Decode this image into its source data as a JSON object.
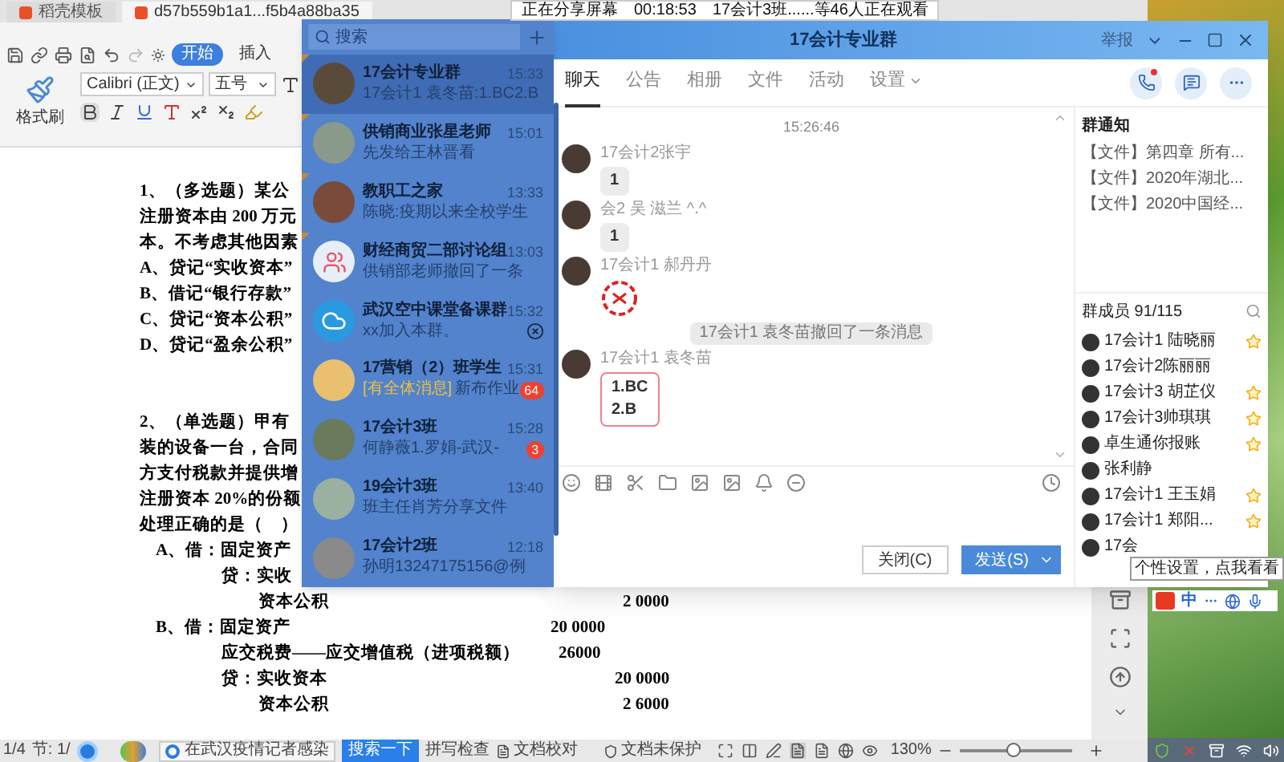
{
  "share_bar": {
    "status": "正在分享屏幕",
    "duration": "00:18:53",
    "viewers": "17会计3班......等46人正在观看"
  },
  "document_window": {
    "tabs": [
      {
        "label": "稻壳模板",
        "selected": false
      },
      {
        "label": "d57b559b1a1...f5b4a88ba35",
        "selected": true
      }
    ],
    "ribbon_tabs": [
      {
        "label": "开始",
        "selected": true
      },
      {
        "label": "插入",
        "selected": false
      }
    ],
    "format_painter": "格式刷",
    "font": "Calibri (正文)",
    "font_size": "五号",
    "lines": [
      {
        "kind": "question",
        "text": "1、（多选题）某公"
      },
      {
        "kind": "question",
        "text": "注册资本由 200 万元"
      },
      {
        "kind": "question",
        "text": "本。不考虑其他因素"
      },
      {
        "kind": "question",
        "text": "A、贷记“实收资本”"
      },
      {
        "kind": "question",
        "text": "B、借记“银行存款”"
      },
      {
        "kind": "question",
        "text": "C、贷记“资本公积”"
      },
      {
        "kind": "question",
        "text": "D、贷记“盈余公积”"
      },
      {
        "kind": "gap"
      },
      {
        "kind": "question",
        "text": "2、（单选题）甲有"
      },
      {
        "kind": "question",
        "text": "装的设备一台，合同"
      },
      {
        "kind": "question",
        "text": "方支付税款并提供增"
      },
      {
        "kind": "question",
        "text": "注册资本 20%的份额"
      },
      {
        "kind": "question",
        "text": "处理正确的是（　）"
      },
      {
        "kind": "entry",
        "text": "A、借：固定资产"
      },
      {
        "kind": "credit",
        "text": "贷：实收"
      },
      {
        "kind": "account",
        "text": "资本公积",
        "amount": "2 0000"
      },
      {
        "kind": "entry",
        "text": "B、借：固定资产",
        "amount": "20 0000"
      },
      {
        "kind": "tax",
        "text": "应交税费——应交增值税（进项税额）",
        "amount": "26000"
      },
      {
        "kind": "credit",
        "text": "贷：实收资本",
        "amount": "20 0000"
      },
      {
        "kind": "account",
        "text": "资本公积",
        "amount": "2 6000"
      }
    ],
    "status_bar": {
      "page": "1/4",
      "section": "节: 1/",
      "news": "在武汉疫情记者感染",
      "search_button": "搜索一下",
      "spell_check": "拼写检查",
      "proofread": "文档校对",
      "protection": "文档未保护",
      "zoom": "130%",
      "zoom_slider": {
        "level": 0.47
      }
    }
  },
  "chat_list": {
    "search_placeholder": "搜索",
    "items": [
      {
        "name": "17会计专业群",
        "time": "15:33",
        "preview": "17会计1 袁冬苗:1.BC2.B",
        "selected": true,
        "pinned": true,
        "avatar": {
          "kind": "photo"
        },
        "muted": false
      },
      {
        "name": "供销商业张星老师",
        "time": "15:01",
        "preview": "先发给王林晋看",
        "selected": false,
        "pinned": true,
        "avatar": {
          "kind": "photo"
        },
        "muted": false
      },
      {
        "name": "教职工之家",
        "time": "13:33",
        "preview": "陈晓:疫期以来全校学生",
        "selected": false,
        "pinned": true,
        "avatar": {
          "kind": "photo"
        },
        "muted": false
      },
      {
        "name": "财经商贸二部讨论组",
        "time": "13:03",
        "preview": "供销部老师撤回了一条",
        "selected": false,
        "pinned": true,
        "avatar": {
          "kind": "people"
        },
        "muted": false
      },
      {
        "name": "武汉空中课堂备课群",
        "time": "15:32",
        "preview": "xx加入本群。",
        "selected": false,
        "pinned": false,
        "avatar": {
          "kind": "cloud"
        },
        "muted": true
      },
      {
        "name": "17营销（2）班学生",
        "time": "15:31",
        "tag": "[有全体消息]",
        "preview": "新布作业",
        "badge": "64",
        "selected": false,
        "pinned": false,
        "avatar": {
          "kind": "photo"
        },
        "muted": false
      },
      {
        "name": "17会计3班",
        "time": "15:28",
        "preview": "何静薇1.罗娟-武汉-",
        "badge": "3",
        "selected": false,
        "pinned": false,
        "avatar": {
          "kind": "photo"
        },
        "muted": false
      },
      {
        "name": "19会计3班",
        "time": "13:40",
        "preview": "班主任肖芳分享文件",
        "selected": false,
        "pinned": false,
        "avatar": {
          "kind": "photo"
        },
        "muted": false
      },
      {
        "name": "17会计2班",
        "time": "12:18",
        "preview": "孙明13247175156@例",
        "selected": false,
        "pinned": false,
        "avatar": {
          "kind": "photo"
        },
        "muted": false
      }
    ]
  },
  "chat_window": {
    "title": "17会计专业群",
    "report": "举报",
    "tabs": [
      {
        "label": "聊天",
        "selected": true
      },
      {
        "label": "公告",
        "selected": false
      },
      {
        "label": "相册",
        "selected": false
      },
      {
        "label": "文件",
        "selected": false
      },
      {
        "label": "活动",
        "selected": false
      },
      {
        "label": "设置",
        "selected": false
      }
    ],
    "messages": [
      {
        "kind": "time",
        "text": "15:26:46"
      },
      {
        "kind": "text",
        "sender": "17会计2张宇",
        "lines": [
          "1"
        ],
        "highlighted": false
      },
      {
        "kind": "text",
        "sender": "会2 吴 滋兰 ^.^",
        "lines": [
          "1"
        ],
        "highlighted": false
      },
      {
        "kind": "sticker",
        "sender": "17会计1 郝丹丹"
      },
      {
        "kind": "system",
        "text": "17会计1 袁冬苗撤回了一条消息"
      },
      {
        "kind": "text",
        "sender": "17会计1 袁冬苗",
        "lines": [
          "1.BC",
          "2.B"
        ],
        "highlighted": true
      }
    ],
    "buttons": {
      "close": "关闭(C)",
      "send": "发送(S)"
    },
    "notice_title": "群通知",
    "notices": [
      "【文件】第四章 所有...",
      "【文件】2020年湖北...",
      "【文件】2020中国经..."
    ],
    "members_title": "群成员 91/115",
    "members": [
      {
        "name": "17会计1 陆晓丽",
        "starred": true
      },
      {
        "name": "17会计2陈丽丽",
        "starred": false
      },
      {
        "name": "17会计3 胡芷仪",
        "starred": true
      },
      {
        "name": "17会计3帅琪琪",
        "starred": true
      },
      {
        "name": "卓生通你报账",
        "starred": true
      },
      {
        "name": "张利静",
        "starred": false
      },
      {
        "name": "17会计1 王玉娟",
        "starred": true
      },
      {
        "name": "17会计1 郑阳...",
        "starred": true
      },
      {
        "name": "17会",
        "starred": false
      }
    ]
  },
  "tooltip": "个性设置，点我看看",
  "ime": {
    "mode": "中"
  }
}
